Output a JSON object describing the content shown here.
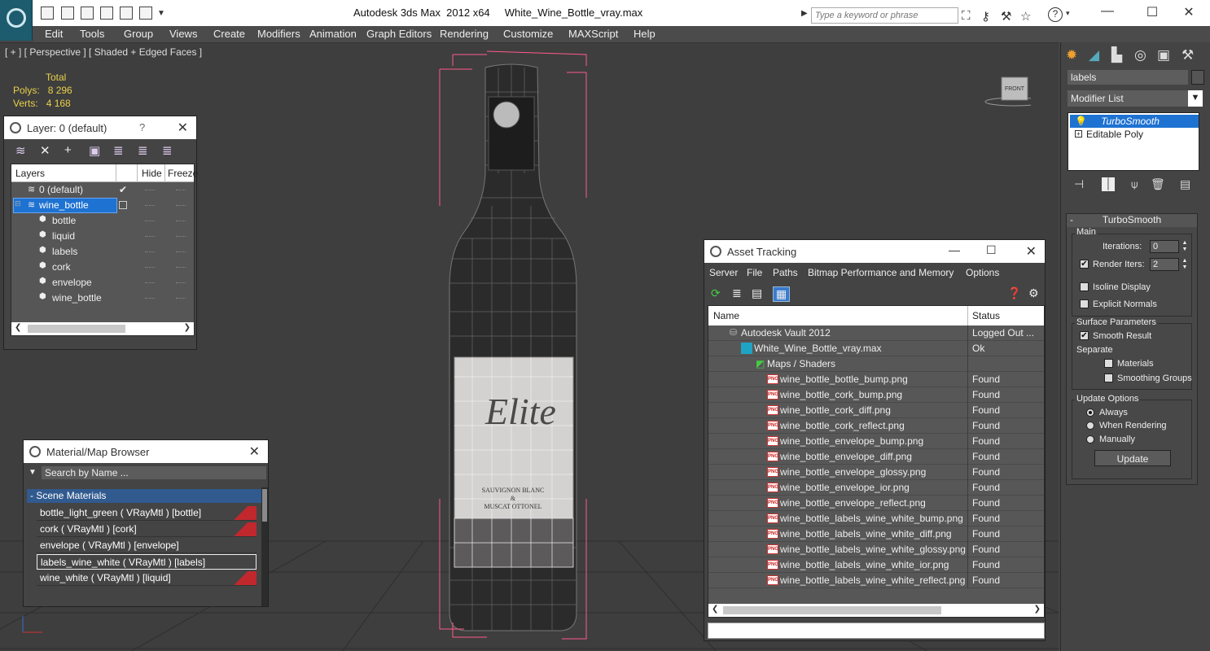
{
  "titlebar": {
    "app": "Autodesk 3ds Max  2012 x64",
    "file": "White_Wine_Bottle_vray.max",
    "search_placeholder": "Type a keyword or phrase",
    "help": "?"
  },
  "menu": [
    "Edit",
    "Tools",
    "Group",
    "Views",
    "Create",
    "Modifiers",
    "Animation",
    "Graph Editors",
    "Rendering",
    "Customize",
    "MAXScript",
    "Help"
  ],
  "viewport": {
    "label": "[ + ] [ Perspective ] [ Shaded + Edged Faces ]",
    "stats": {
      "header": "Total",
      "polys_label": "Polys:",
      "polys": "8 296",
      "verts_label": "Verts:",
      "verts": "4 168"
    },
    "viewcube_label": "FRONT",
    "bottle_label_lines": [
      "SAUVIGNON BLANC",
      "&",
      "MUSCAT OTTONEL"
    ],
    "bottle_brand": "Elite"
  },
  "layer_panel": {
    "title": "Layer: 0 (default)",
    "help": "?",
    "headers": {
      "layers": "Layers",
      "hide": "Hide",
      "freeze": "Freeze"
    },
    "rows": [
      {
        "name": "0 (default)",
        "level": 0,
        "type": "layer"
      },
      {
        "name": "wine_bottle",
        "level": 0,
        "type": "layer",
        "selected": true
      },
      {
        "name": "bottle",
        "level": 1,
        "type": "object"
      },
      {
        "name": "liquid",
        "level": 1,
        "type": "object"
      },
      {
        "name": "labels",
        "level": 1,
        "type": "object"
      },
      {
        "name": "cork",
        "level": 1,
        "type": "object"
      },
      {
        "name": "envelope",
        "level": 1,
        "type": "object"
      },
      {
        "name": "wine_bottle",
        "level": 1,
        "type": "object"
      }
    ]
  },
  "material_panel": {
    "title": "Material/Map Browser",
    "search_placeholder": "Search by Name ...",
    "section": "- Scene Materials",
    "items": [
      {
        "label": "bottle_light_green  ( VRayMtl ) [bottle]",
        "swatch": true
      },
      {
        "label": "cork  ( VRayMtl ) [cork]",
        "swatch": true
      },
      {
        "label": "envelope  ( VRayMtl ) [envelope]",
        "swatch": false
      },
      {
        "label": "labels_wine_white  ( VRayMtl ) [labels]",
        "swatch": false,
        "selected": true
      },
      {
        "label": "wine_white  ( VRayMtl ) [liquid]",
        "swatch": true
      }
    ]
  },
  "asset_panel": {
    "title": "Asset Tracking",
    "menu": [
      "Server",
      "File",
      "Paths",
      "Bitmap Performance and Memory",
      "Options"
    ],
    "headers": {
      "name": "Name",
      "status": "Status"
    },
    "rows": [
      {
        "name": "Autodesk Vault 2012",
        "status": "Logged Out ...",
        "level": 0,
        "icon": "vault-icon"
      },
      {
        "name": "White_Wine_Bottle_vray.max",
        "status": "Ok",
        "level": 1,
        "icon": "max-file-icon"
      },
      {
        "name": "Maps / Shaders",
        "status": "",
        "level": 2,
        "icon": "maps-icon"
      },
      {
        "name": "wine_bottle_bottle_bump.png",
        "status": "Found",
        "level": 3,
        "icon": "png-icon"
      },
      {
        "name": "wine_bottle_cork_bump.png",
        "status": "Found",
        "level": 3,
        "icon": "png-icon"
      },
      {
        "name": "wine_bottle_cork_diff.png",
        "status": "Found",
        "level": 3,
        "icon": "png-icon"
      },
      {
        "name": "wine_bottle_cork_reflect.png",
        "status": "Found",
        "level": 3,
        "icon": "png-icon"
      },
      {
        "name": "wine_bottle_envelope_bump.png",
        "status": "Found",
        "level": 3,
        "icon": "png-icon"
      },
      {
        "name": "wine_bottle_envelope_diff.png",
        "status": "Found",
        "level": 3,
        "icon": "png-icon"
      },
      {
        "name": "wine_bottle_envelope_glossy.png",
        "status": "Found",
        "level": 3,
        "icon": "png-icon"
      },
      {
        "name": "wine_bottle_envelope_ior.png",
        "status": "Found",
        "level": 3,
        "icon": "png-icon"
      },
      {
        "name": "wine_bottle_envelope_reflect.png",
        "status": "Found",
        "level": 3,
        "icon": "png-icon"
      },
      {
        "name": "wine_bottle_labels_wine_white_bump.png",
        "status": "Found",
        "level": 3,
        "icon": "png-icon"
      },
      {
        "name": "wine_bottle_labels_wine_white_diff.png",
        "status": "Found",
        "level": 3,
        "icon": "png-icon"
      },
      {
        "name": "wine_bottle_labels_wine_white_glossy.png",
        "status": "Found",
        "level": 3,
        "icon": "png-icon"
      },
      {
        "name": "wine_bottle_labels_wine_white_ior.png",
        "status": "Found",
        "level": 3,
        "icon": "png-icon"
      },
      {
        "name": "wine_bottle_labels_wine_white_reflect.png",
        "status": "Found",
        "level": 3,
        "icon": "png-icon"
      }
    ],
    "png_badge": "PNG"
  },
  "command_panel": {
    "object_name": "labels",
    "modifier_list": "Modifier List",
    "stack": [
      {
        "label": "TurboSmooth",
        "selected": true
      },
      {
        "label": "Editable Poly",
        "selected": false
      }
    ],
    "turbosmooth": {
      "title": "TurboSmooth",
      "collapse": "-",
      "main_group": "Main",
      "iterations_label": "Iterations:",
      "iterations": "0",
      "render_iters_label": "Render Iters:",
      "render_iters": "2",
      "render_iters_checked": true,
      "isoline_label": "Isoline Display",
      "isoline_checked": false,
      "explicit_label": "Explicit Normals",
      "explicit_checked": false,
      "surface_group": "Surface Parameters",
      "smooth_result_label": "Smooth Result",
      "smooth_result_checked": true,
      "separate_label": "Separate",
      "materials_label": "Materials",
      "smoothing_groups_label": "Smoothing Groups",
      "update_group": "Update Options",
      "always_label": "Always",
      "when_rendering_label": "When Rendering",
      "manually_label": "Manually",
      "update_button": "Update"
    }
  },
  "colors": {
    "selection": "#1e72d2",
    "stats_yellow": "#e8d04a",
    "bbox_pink": "#ff5a8c",
    "material_red": "#c0282e"
  }
}
